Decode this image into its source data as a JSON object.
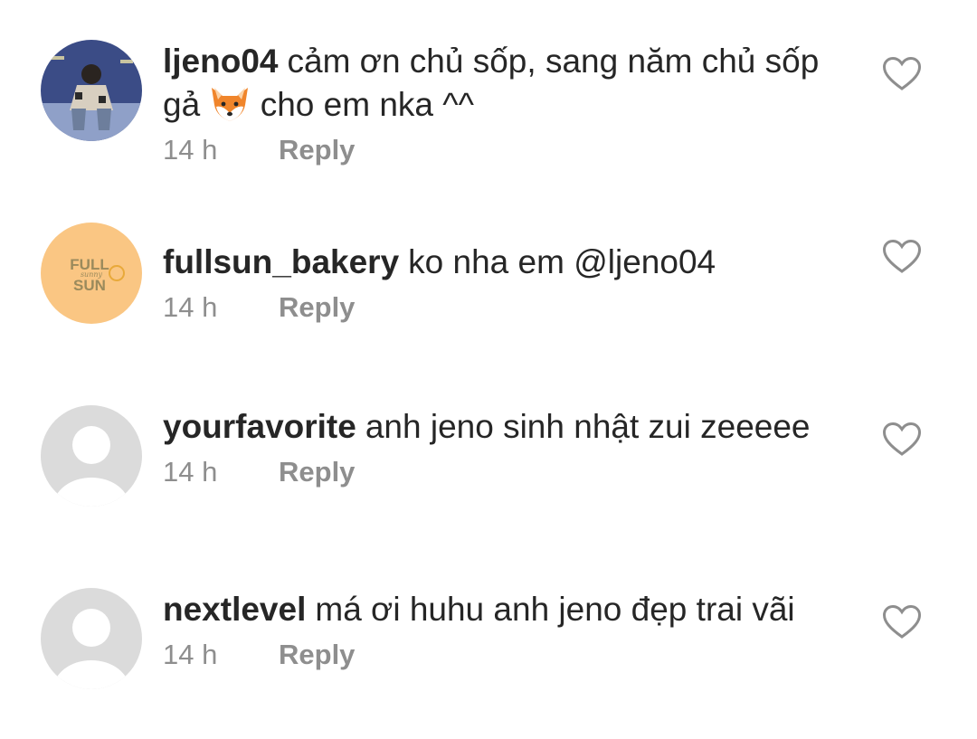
{
  "comments": [
    {
      "username": "ljeno04",
      "text_before_emoji": "cảm ơn chủ sốp, sang năm chủ sốp gả",
      "emoji": "fox-emoji",
      "text_after_emoji": "cho em nka ^^",
      "time": "14 h",
      "reply_label": "Reply",
      "avatar": "photo-avatar",
      "liked": false
    },
    {
      "username": "fullsun_bakery",
      "text": "ko nha em @ljeno04",
      "time": "14 h",
      "reply_label": "Reply",
      "avatar": "logo-avatar",
      "avatar_logo": {
        "line1": "FULL",
        "line2": "SUN",
        "script": "sunny",
        "bg": "#fac683",
        "color": "#9a8a5c"
      },
      "liked": false
    },
    {
      "username": "yourfavorite",
      "text": "anh jeno sinh nhật zui zeeeee",
      "time": "14 h",
      "reply_label": "Reply",
      "avatar": "default-avatar",
      "liked": false
    },
    {
      "username": "nextlevel",
      "text": "má ơi huhu anh jeno đẹp trai vãi",
      "time": "14 h",
      "reply_label": "Reply",
      "avatar": "default-avatar",
      "liked": false
    }
  ],
  "colors": {
    "text": "#262626",
    "secondary": "#8e8e8e",
    "default_avatar_bg": "#dbdbdb"
  },
  "icons": {
    "like": "heart-outline-icon"
  }
}
